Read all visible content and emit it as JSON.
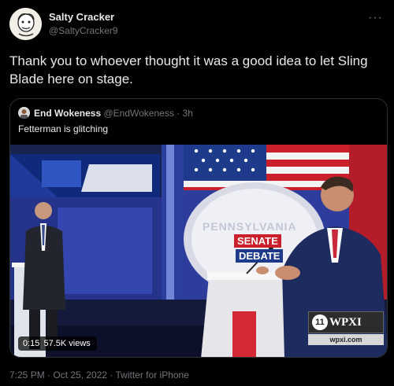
{
  "tweet": {
    "author_name": "Salty Cracker",
    "author_handle": "@SaltyCracker9",
    "more_icon": "more-dots-icon",
    "text": "Thank you to whoever thought it was a good idea to let Sling Blade here on stage."
  },
  "quote": {
    "author_name": "End Wokeness",
    "author_handle": "@EndWokeness",
    "separator": "·",
    "time": "3h",
    "text": "Fetterman is glitching"
  },
  "video": {
    "duration": "0:15",
    "views": "57.5K views",
    "sign": {
      "line1": "PENNSYLVANIA",
      "line2": "SENATE",
      "line3": "DEBATE"
    },
    "station": "WPXI",
    "station_url": "wpxi.com",
    "station_logo": "11"
  },
  "footer": {
    "timestamp": "7:25 PM · Oct 25, 2022 · Twitter for iPhone"
  },
  "colors": {
    "background": "#000000",
    "primary_text": "#e7e9ea",
    "secondary_text": "#71767b",
    "border": "#2f3336"
  }
}
